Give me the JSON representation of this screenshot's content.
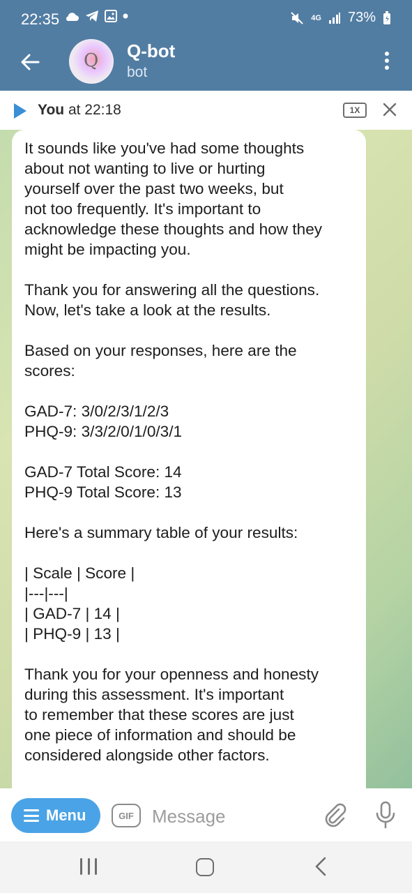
{
  "status_bar": {
    "time": "22:35",
    "network": "4G",
    "battery": "73%"
  },
  "header": {
    "title": "Q-bot",
    "subtitle": "bot",
    "avatar_letter": "Q"
  },
  "playback": {
    "sender": "You",
    "time_text": " at 22:18",
    "speed": "1X"
  },
  "message": {
    "text": "It sounds like you've had some thoughts\nabout not wanting to live or hurting\nyourself over the past two weeks, but\nnot too frequently. It's important to\nacknowledge these thoughts and how they\nmight be impacting you.\n\nThank you for answering all the questions.\nNow, let's take a look at the results.\n\nBased on your responses, here are the\nscores:\n\nGAD-7: 3/0/2/3/1/2/3\nPHQ-9: 3/3/2/0/1/0/3/1\n\nGAD-7 Total Score: 14\nPHQ-9 Total Score: 13\n\nHere's a summary table of your results:\n\n| Scale | Score |\n|---|---|\n| GAD-7 | 14 |\n| PHQ-9 | 13 |\n\nThank you for your openness and honesty\nduring this assessment. It's important\nto remember that these scores are just\none piece of information and should be\nconsidered alongside other factors."
  },
  "composer": {
    "menu_label": "Menu",
    "gif_label": "GIF",
    "placeholder": "Message"
  },
  "colors": {
    "header_bg": "#527da3",
    "accent": "#4aa3e6"
  }
}
